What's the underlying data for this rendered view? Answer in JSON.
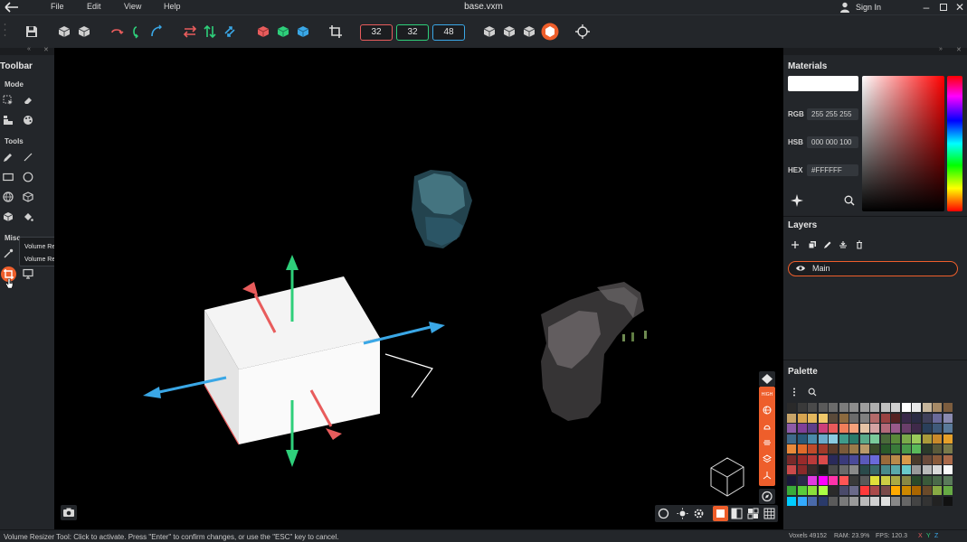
{
  "window": {
    "title": "base.vxm",
    "menu": [
      "File",
      "Edit",
      "View",
      "Help"
    ],
    "signin_label": "Sign In"
  },
  "toolbar": {
    "dims": {
      "x": "32",
      "y": "32",
      "z": "48"
    },
    "colors": {
      "x": "#e85c5c",
      "y": "#2ecf7a",
      "z": "#3aa7e6",
      "accent": "#ee5e2b"
    }
  },
  "left_panel": {
    "title": "Toolbar",
    "sections": {
      "mode": "Mode",
      "tools": "Tools",
      "misc": "Misc"
    }
  },
  "tooltip": {
    "line1": "Volume Resizer (V)",
    "line2": "Volume Resizer Tool"
  },
  "materials": {
    "title": "Materials",
    "rgb_label": "RGB",
    "rgb_value": "255 255 255",
    "hsb_label": "HSB",
    "hsb_value": "000 000 100",
    "hex_label": "HEX",
    "hex_value": "#FFFFFF"
  },
  "layers": {
    "title": "Layers",
    "items": [
      {
        "label": "Main"
      }
    ]
  },
  "palette": {
    "title": "Palette",
    "colors": [
      "#2a2a2a",
      "#3a3a3a",
      "#4a4a4a",
      "#5a5a5a",
      "#6b6b6b",
      "#7c7c7c",
      "#8d8d8d",
      "#9e9e9e",
      "#afafaf",
      "#c0c0c0",
      "#d1d1d1",
      "#ffffff",
      "#e8e8e8",
      "#c6b59b",
      "#a78a66",
      "#7d5d3e",
      "#c8a468",
      "#d6a450",
      "#e3b75d",
      "#f0c86a",
      "#5a4a3a",
      "#8c6a3f",
      "#6b6b6b",
      "#808080",
      "#b36a6a",
      "#9a4242",
      "#552222",
      "#3a2a4a",
      "#2b2b44",
      "#40405a",
      "#6a6a9a",
      "#8a8ab0",
      "#8d5ba7",
      "#7f3f98",
      "#5e3f8a",
      "#cc3f7a",
      "#e95a5a",
      "#ef7e5a",
      "#f4a07a",
      "#e5c3a5",
      "#d4a3a3",
      "#b46a7a",
      "#9a5a8a",
      "#6a3f6a",
      "#3f2a4a",
      "#2a3f5a",
      "#3f5a7a",
      "#5a7a9a",
      "#3f6a8a",
      "#2a5a7a",
      "#4a8aaa",
      "#6aaaca",
      "#8acae0",
      "#3f9a8a",
      "#2a7a6a",
      "#5aaa8a",
      "#7aca9a",
      "#4a6a3a",
      "#5a8a3a",
      "#7aaa4a",
      "#9aca5a",
      "#aa9a3a",
      "#ca8a2a",
      "#e6a02a",
      "#ea8a3a",
      "#e06a2a",
      "#c04a2a",
      "#a03a2a",
      "#5a3a2a",
      "#7a5a3a",
      "#9a7a4a",
      "#ba9a6a",
      "#3a4a2a",
      "#2a5a2a",
      "#3a7a3a",
      "#4a9a4a",
      "#5aba5a",
      "#2a3a2a",
      "#5a5a3a",
      "#7a7a4a",
      "#7a2a2a",
      "#9a2a2a",
      "#ba3a3a",
      "#da4a4a",
      "#2a2a5a",
      "#3a3a7a",
      "#4a4a9a",
      "#5a5aba",
      "#6a6ada",
      "#9a6a3a",
      "#ba8a4a",
      "#da9a4a",
      "#4a3a2a",
      "#6a4a3a",
      "#8a5a3a",
      "#aa6a4a",
      "#ca4a4a",
      "#8a2a2a",
      "#3a2a2a",
      "#1a1a1a",
      "#4a4a4a",
      "#6a6a6a",
      "#8a8a8a",
      "#2a4a4a",
      "#3a6a6a",
      "#4a8a8a",
      "#5aaaaa",
      "#6acaca",
      "#9a9a9a",
      "#bababa",
      "#dadada",
      "#fafafa",
      "#1a1a3a",
      "#2a2a4a",
      "#e03ae0",
      "#ff00ff",
      "#ff33aa",
      "#ff5555",
      "#3a3a3a",
      "#5a5a5a",
      "#e0e03a",
      "#cccc44",
      "#aaaa44",
      "#888844",
      "#2a4a2a",
      "#3a5a3a",
      "#4a6a4a",
      "#5a7a5a",
      "#3aaa3a",
      "#5acc3a",
      "#8ae03a",
      "#aaff44",
      "#2a2a2a",
      "#4a4a6a",
      "#6a6a8a",
      "#ff3a3a",
      "#aa4a4a",
      "#7a4a4a",
      "#ffaa00",
      "#cc8800",
      "#aa6600",
      "#6a4a2a",
      "#88aa44",
      "#66aa44",
      "#00ccff",
      "#33aaff",
      "#4a6aaa",
      "#2a3a6a",
      "#5a5a5a",
      "#7a7a7a",
      "#9a9a9a",
      "#bababa",
      "#d0d0d0",
      "#e0e0e0",
      "#888888",
      "#666666",
      "#444444",
      "#333333",
      "#222222",
      "#111111"
    ]
  },
  "status": {
    "message": "Volume Resizer Tool: Click to activate. Press \"Enter\" to confirm changes, or use the \"ESC\" key to cancel.",
    "voxels": "Voxels 49152",
    "ram": "RAM: 23.9%",
    "fps": "FPS: 120.3",
    "axis_x": "X",
    "axis_y": "Y",
    "axis_z": "Z"
  },
  "render_strip": {
    "quality": "HIGH"
  }
}
